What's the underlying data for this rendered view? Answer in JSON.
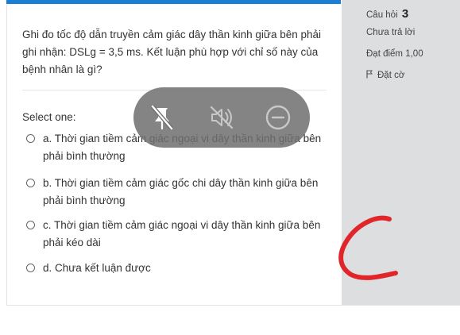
{
  "question": {
    "text": "Ghi đo tốc độ dẫn truyền cảm giác dây thần kinh giữa bên phải ghi nhận: DSLg = 3,5 ms. Kết luận phù hợp với chỉ số này của bệnh nhân là gì?",
    "select_label": "Select one:",
    "options": [
      "a. Thời gian tiềm cảm giác ngoại vi dây thần kinh giữa bên phải bình thường",
      "b. Thời gian tiềm cảm giác gốc chi dây thần kinh giữa bên phải bình thường",
      "c. Thời gian tiềm cảm giác ngoại vi dây thần kinh giữa bên phải kéo dài",
      "d. Chưa kết luận được"
    ]
  },
  "sidebar": {
    "question_label": "Câu hỏi",
    "question_number": "3",
    "status": "Chưa trả lời",
    "grade": "Đạt điểm 1,00",
    "flag_label": "Đặt cờ"
  },
  "overlay": {
    "icons": [
      "touch-off-icon",
      "sound-off-icon",
      "minus-circle-icon"
    ]
  },
  "colors": {
    "accent_bar": "#1a7fd4",
    "sidebar_bg": "#dcdedf",
    "overlay_bg": "#6e6e6e",
    "scribble": "#e0262b"
  }
}
